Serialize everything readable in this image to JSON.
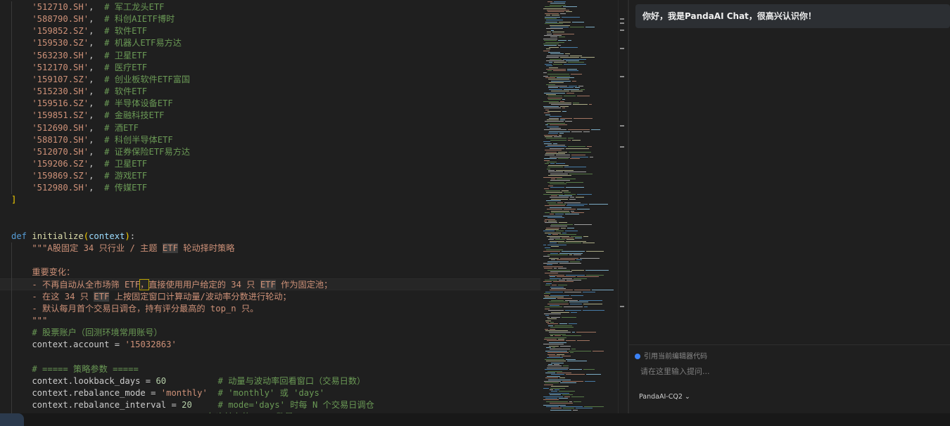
{
  "editor": {
    "lines": [
      [
        [
          "s",
          "    '512710.SH'"
        ],
        [
          "p",
          ",  "
        ],
        [
          "c",
          "# 军工龙头ETF"
        ]
      ],
      [
        [
          "s",
          "    '588790.SH'"
        ],
        [
          "p",
          ",  "
        ],
        [
          "c",
          "# 科创AIETF博时"
        ]
      ],
      [
        [
          "s",
          "    '159852.SZ'"
        ],
        [
          "p",
          ",  "
        ],
        [
          "c",
          "# 软件ETF"
        ]
      ],
      [
        [
          "s",
          "    '159530.SZ'"
        ],
        [
          "p",
          ",  "
        ],
        [
          "c",
          "# 机器人ETF易方达"
        ]
      ],
      [
        [
          "s",
          "    '563230.SH'"
        ],
        [
          "p",
          ",  "
        ],
        [
          "c",
          "# 卫星ETF"
        ]
      ],
      [
        [
          "s",
          "    '512170.SH'"
        ],
        [
          "p",
          ",  "
        ],
        [
          "c",
          "# 医疗ETF"
        ]
      ],
      [
        [
          "s",
          "    '159107.SZ'"
        ],
        [
          "p",
          ",  "
        ],
        [
          "c",
          "# 创业板软件ETF富国"
        ]
      ],
      [
        [
          "s",
          "    '515230.SH'"
        ],
        [
          "p",
          ",  "
        ],
        [
          "c",
          "# 软件ETF"
        ]
      ],
      [
        [
          "s",
          "    '159516.SZ'"
        ],
        [
          "p",
          ",  "
        ],
        [
          "c",
          "# 半导体设备ETF"
        ]
      ],
      [
        [
          "s",
          "    '159851.SZ'"
        ],
        [
          "p",
          ",  "
        ],
        [
          "c",
          "# 金融科技ETF"
        ]
      ],
      [
        [
          "s",
          "    '512690.SH'"
        ],
        [
          "p",
          ",  "
        ],
        [
          "c",
          "# 酒ETF"
        ]
      ],
      [
        [
          "s",
          "    '588170.SH'"
        ],
        [
          "p",
          ",  "
        ],
        [
          "c",
          "# 科创半导体ETF"
        ]
      ],
      [
        [
          "s",
          "    '512070.SH'"
        ],
        [
          "p",
          ",  "
        ],
        [
          "c",
          "# 证券保险ETF易方达"
        ]
      ],
      [
        [
          "s",
          "    '159206.SZ'"
        ],
        [
          "p",
          ",  "
        ],
        [
          "c",
          "# 卫星ETF"
        ]
      ],
      [
        [
          "s",
          "    '159869.SZ'"
        ],
        [
          "p",
          ",  "
        ],
        [
          "c",
          "# 游戏ETF"
        ]
      ],
      [
        [
          "s",
          "    '512980.SH'"
        ],
        [
          "p",
          ",  "
        ],
        [
          "c",
          "# 传媒ETF"
        ]
      ],
      [
        [
          "b",
          "]"
        ]
      ],
      [],
      [],
      [
        [
          "k",
          "def "
        ],
        [
          "f",
          "initialize"
        ],
        [
          "b",
          "("
        ],
        [
          "v",
          "context"
        ],
        [
          "b",
          ")"
        ],
        [
          "p",
          ":"
        ]
      ],
      [
        [
          "s",
          "    \"\"\"A股固定 34 只行业 / 主题 "
        ],
        [
          "sh",
          "ETF"
        ],
        [
          "s",
          " 轮动择时策略"
        ]
      ],
      [],
      [
        [
          "s",
          "    重要变化："
        ]
      ],
      [
        [
          "s",
          "    - 不再自动从全市场筛 ETF"
        ],
        [
          "scur",
          "，"
        ],
        [
          "s",
          "直接使用用户给定的 34 只 "
        ],
        [
          "sh",
          "ETF"
        ],
        [
          "s",
          " 作为固定池；"
        ]
      ],
      [
        [
          "s",
          "    - 在这 34 只 "
        ],
        [
          "sh",
          "ETF"
        ],
        [
          "s",
          " 上按固定窗口计算动量/波动率分数进行轮动；"
        ]
      ],
      [
        [
          "s",
          "    - 默认每月首个交易日调仓，持有评分最高的 top_n 只。"
        ]
      ],
      [
        [
          "s",
          "    \"\"\""
        ]
      ],
      [
        [
          "c",
          "    # 股票账户（回测环境常用账号）"
        ]
      ],
      [
        [
          "p",
          "    context.account = "
        ],
        [
          "s",
          "'15032863'"
        ]
      ],
      [],
      [
        [
          "c",
          "    # ===== 策略参数 ====="
        ]
      ],
      [
        [
          "p",
          "    context.lookback_days = "
        ],
        [
          "n",
          "60"
        ],
        [
          "p",
          "          "
        ],
        [
          "c",
          "# 动量与波动率回看窗口（交易日数）"
        ]
      ],
      [
        [
          "p",
          "    context.rebalance_mode = "
        ],
        [
          "s",
          "'monthly'"
        ],
        [
          "p",
          "  "
        ],
        [
          "c",
          "# 'monthly' 或 'days'"
        ]
      ],
      [
        [
          "p",
          "    context.rebalance_interval = "
        ],
        [
          "n",
          "20"
        ],
        [
          "p",
          "     "
        ],
        [
          "c",
          "# mode='days' 时每 N 个交易日调仓"
        ]
      ],
      [
        [
          "p",
          "                                    "
        ],
        [
          "c",
          "# 每次持有的 ETF 数量"
        ]
      ]
    ]
  },
  "chat": {
    "greeting": "你好，我是PandaAI Chat，很高兴认识你！",
    "reference_label": "引用当前编辑器代码",
    "input_placeholder": "请在这里输入提问...",
    "model": "PandaAI-CQ2",
    "model_chevron": "⌄"
  }
}
